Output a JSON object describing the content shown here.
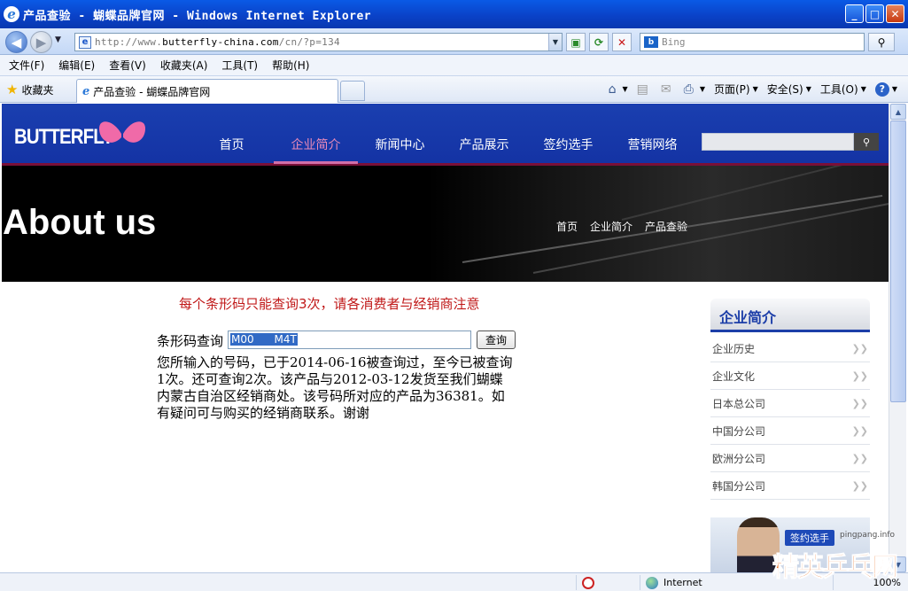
{
  "window": {
    "title": "产品查验 - 蝴蝶品牌官网 - Windows Internet Explorer",
    "min": "_",
    "max": "□",
    "close": "✕"
  },
  "address": {
    "url_prefix": "http://www.",
    "url_domain": "butterfly-china.com",
    "url_suffix": "/cn/?p=134",
    "search_placeholder": "Bing"
  },
  "menu": [
    "文件(F)",
    "编辑(E)",
    "查看(V)",
    "收藏夹(A)",
    "工具(T)",
    "帮助(H)"
  ],
  "favbar": {
    "favorites_label": "收藏夹",
    "tab_title": "产品查验 - 蝴蝶品牌官网",
    "page_label": "页面(P)",
    "safety_label": "安全(S)",
    "tools_label": "工具(O)"
  },
  "site": {
    "logo_text": "BUTTERFLY",
    "nav": [
      "首页",
      "企业简介",
      "新闻中心",
      "产品展示",
      "签约选手",
      "营销网络"
    ],
    "banner_title": "About us",
    "breadcrumb": [
      "首页",
      "企业简介",
      "产品查验"
    ]
  },
  "query": {
    "notice": "每个条形码只能查询3次，请各消费者与经销商注意",
    "label": "条形码查询",
    "input_value": "M00      M4T",
    "button": "查询",
    "result": "您所输入的号码，已于2014-06-16被查询过，至今已被查询1次。还可查询2次。该产品与2012-03-12发货至我们蝴蝶内蒙古自治区经销商处。该号码所对应的产品为36381。如有疑问可与购买的经销商联系。谢谢"
  },
  "sidebar": {
    "heading": "企业简介",
    "items": [
      "企业历史",
      "企业文化",
      "日本总公司",
      "中国分公司",
      "欧洲分公司",
      "韩国分公司"
    ],
    "card_label": "签约选手"
  },
  "status": {
    "zone": "Internet",
    "zoom": "100%"
  },
  "watermark": {
    "url": "pingpang.info",
    "text": "精英乒乓网"
  },
  "colors": {
    "site_blue": "#1a3fb0",
    "nav_active": "#e88ab8",
    "notice_red": "#c01818"
  }
}
